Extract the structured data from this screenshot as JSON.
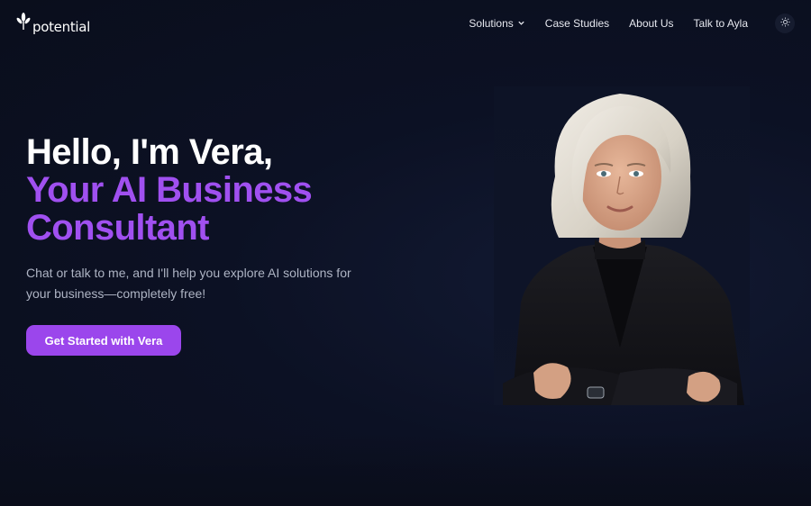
{
  "brand": {
    "logo_text": "potential"
  },
  "nav": {
    "items": [
      {
        "label": "Solutions",
        "has_dropdown": true
      },
      {
        "label": "Case Studies"
      },
      {
        "label": "About Us"
      },
      {
        "label": "Talk to Ayla"
      }
    ],
    "theme_toggle_icon": "sun-icon"
  },
  "hero": {
    "line1": "Hello, I'm Vera,",
    "line2": "Your AI Business",
    "line3": "Consultant",
    "subtext": "Chat or talk to me, and I'll help you explore AI solutions for your business—completely free!",
    "cta_label": "Get Started with Vera"
  },
  "colors": {
    "background": "#0b1020",
    "accent": "#9b46ec",
    "headline_accent": "#a050f0",
    "text_muted": "#aeb4c4"
  }
}
